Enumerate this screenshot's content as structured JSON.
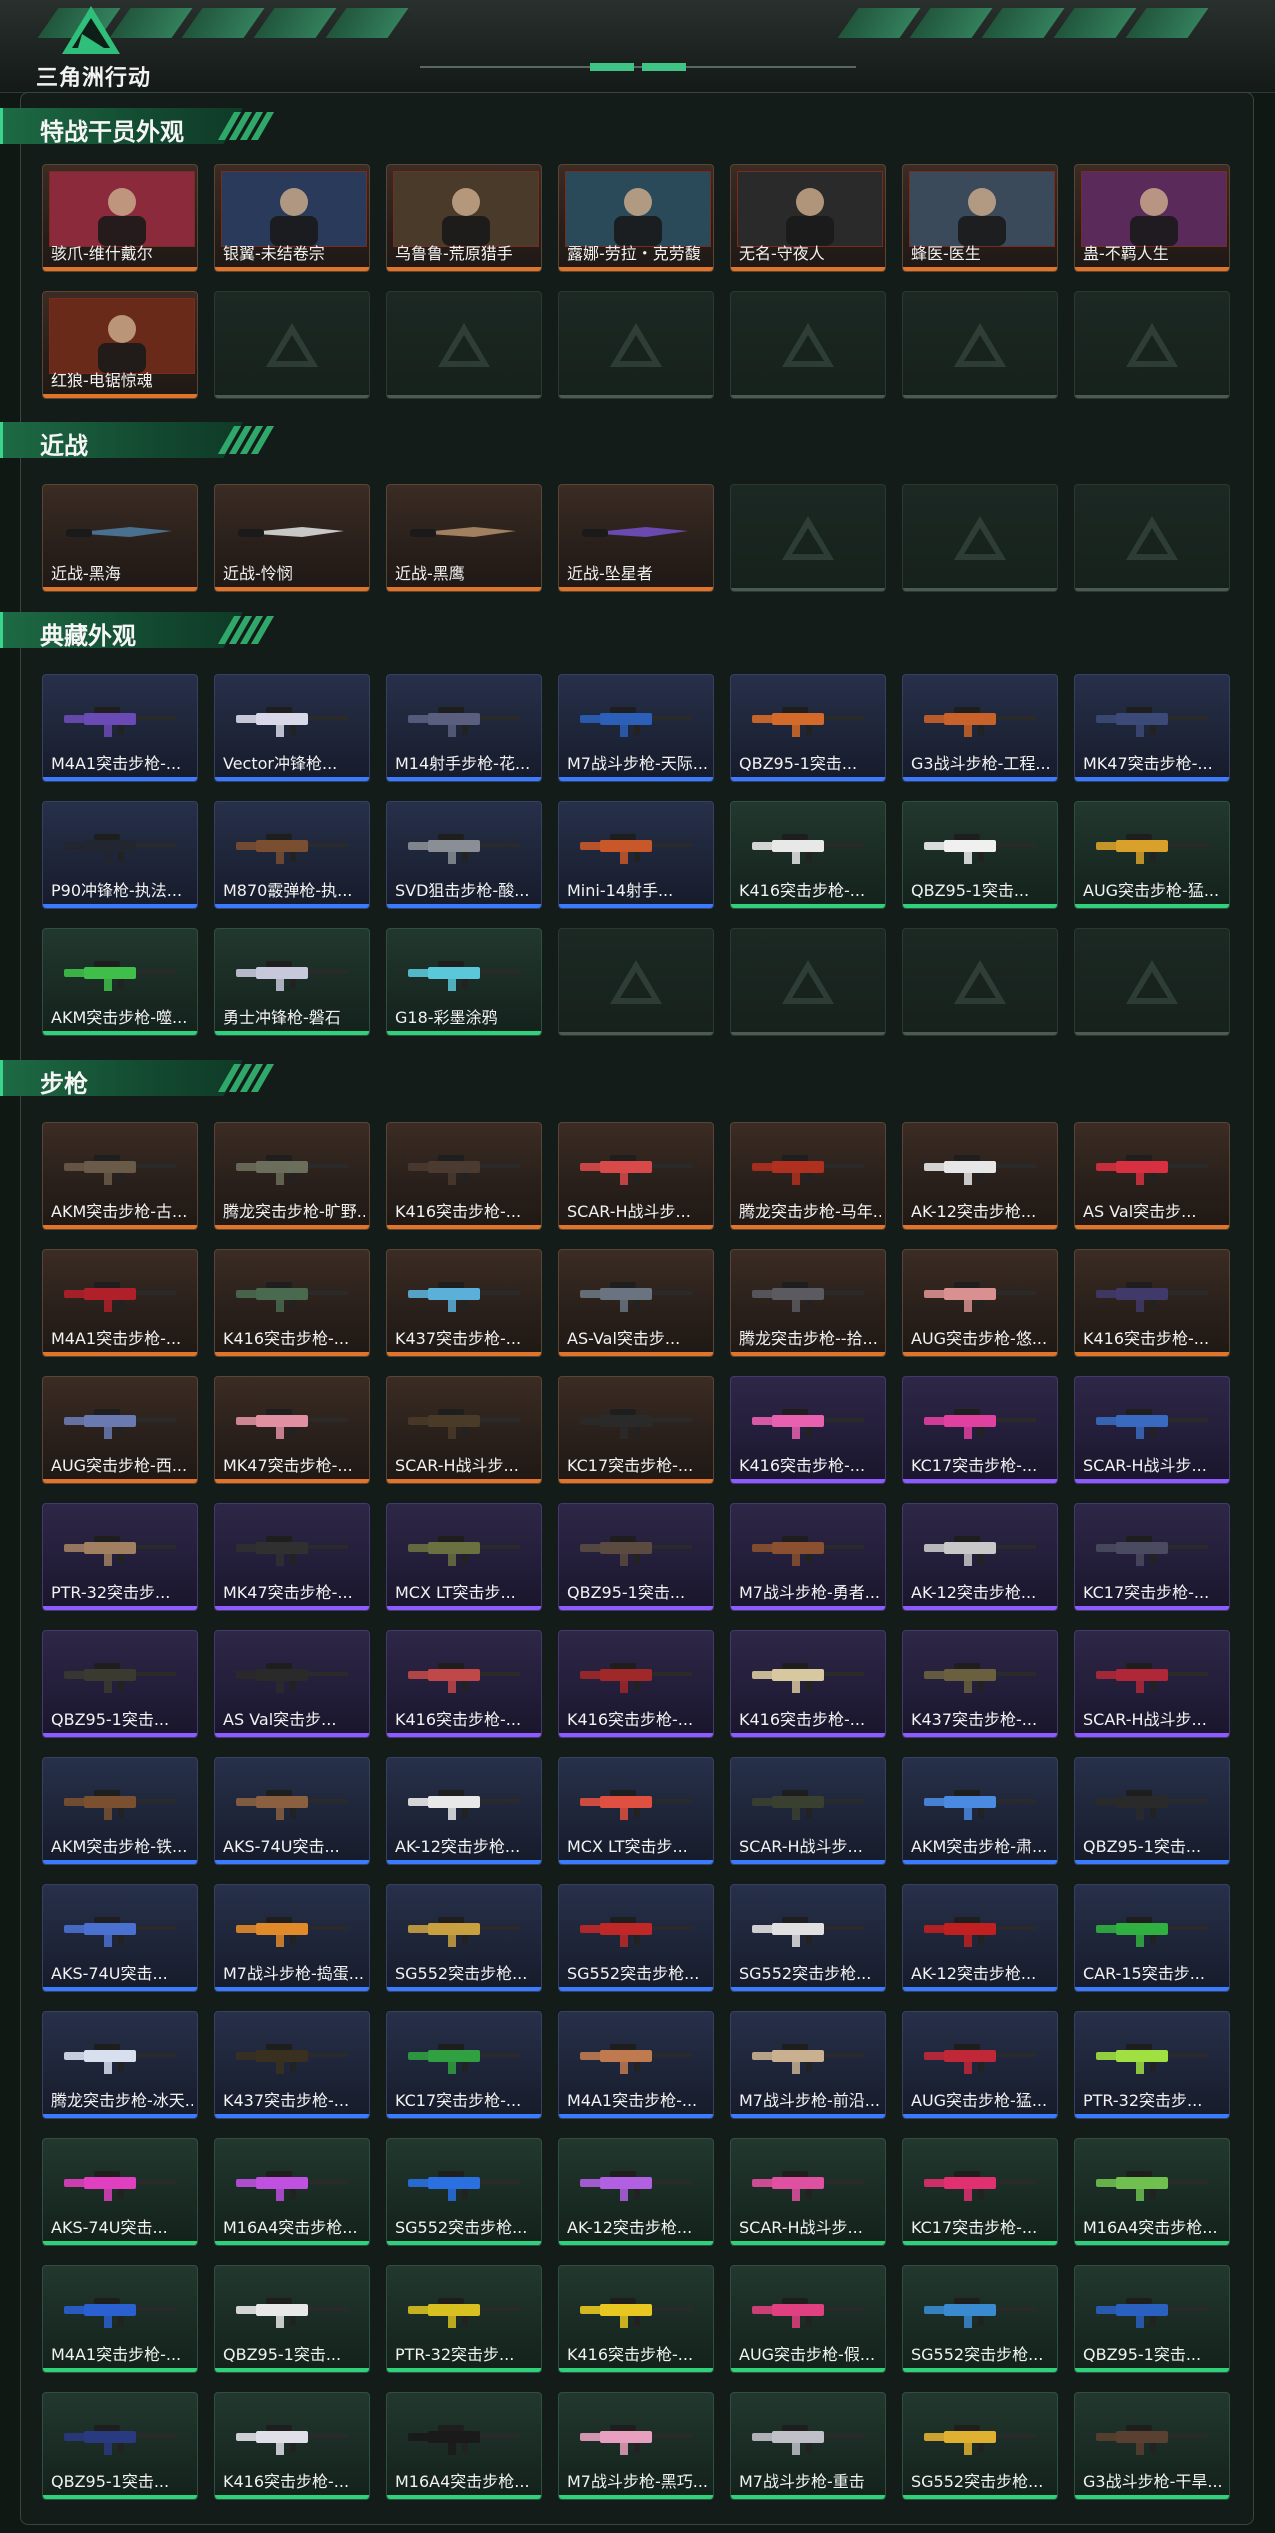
{
  "header": {
    "logo_text": "三角洲行动",
    "logo_icon": "delta-triangle-logo",
    "accent_color": "#3fc486"
  },
  "sections": [
    {
      "title": "特战干员外观",
      "items": [
        {
          "label": "骇爪-维什戴尔",
          "rarity": "gold",
          "kind": "portrait"
        },
        {
          "label": "银翼-未结卷宗",
          "rarity": "gold",
          "kind": "portrait"
        },
        {
          "label": "乌鲁鲁-荒原猎手",
          "rarity": "gold",
          "kind": "portrait"
        },
        {
          "label": "露娜-劳拉・克劳馥",
          "rarity": "gold",
          "kind": "portrait"
        },
        {
          "label": "无名-守夜人",
          "rarity": "gold",
          "kind": "portrait"
        },
        {
          "label": "蜂医-医生",
          "rarity": "gold",
          "kind": "portrait"
        },
        {
          "label": "蛊-不羁人生",
          "rarity": "gold",
          "kind": "portrait"
        },
        {
          "label": "红狼-电锯惊魂",
          "rarity": "gold",
          "kind": "portrait"
        },
        {
          "label": "",
          "rarity": "empty"
        },
        {
          "label": "",
          "rarity": "empty"
        },
        {
          "label": "",
          "rarity": "empty"
        },
        {
          "label": "",
          "rarity": "empty"
        },
        {
          "label": "",
          "rarity": "empty"
        },
        {
          "label": "",
          "rarity": "empty"
        }
      ]
    },
    {
      "title": "近战",
      "items": [
        {
          "label": "近战-黑海",
          "rarity": "gold",
          "kind": "melee"
        },
        {
          "label": "近战-怜悯",
          "rarity": "gold",
          "kind": "melee"
        },
        {
          "label": "近战-黑鹰",
          "rarity": "gold",
          "kind": "melee"
        },
        {
          "label": "近战-坠星者",
          "rarity": "gold",
          "kind": "melee"
        },
        {
          "label": "",
          "rarity": "empty"
        },
        {
          "label": "",
          "rarity": "empty"
        },
        {
          "label": "",
          "rarity": "empty"
        }
      ]
    },
    {
      "title": "典藏外观",
      "items": [
        {
          "label": "M4A1突击步枪-...",
          "rarity": "blue",
          "color": "#6a4bb5"
        },
        {
          "label": "Vector冲锋枪...",
          "rarity": "blue",
          "color": "#d8d8e8"
        },
        {
          "label": "M14射手步枪-花...",
          "rarity": "blue",
          "color": "#5a5f80"
        },
        {
          "label": "M7战斗步枪-天际...",
          "rarity": "blue",
          "color": "#2b5fb8"
        },
        {
          "label": "QBZ95-1突击...",
          "rarity": "blue",
          "color": "#d46a2a"
        },
        {
          "label": "G3战斗步枪-工程...",
          "rarity": "blue",
          "color": "#c8612a"
        },
        {
          "label": "MK47突击步枪-...",
          "rarity": "blue",
          "color": "#3b4a78"
        },
        {
          "label": "P90冲锋枪-执法...",
          "rarity": "blue",
          "color": "#222630"
        },
        {
          "label": "M870霰弹枪-执...",
          "rarity": "blue",
          "color": "#7a4e30"
        },
        {
          "label": "SVD狙击步枪-酸...",
          "rarity": "blue",
          "color": "#8a8f95"
        },
        {
          "label": "Mini-14射手...",
          "rarity": "blue",
          "color": "#c8582a"
        },
        {
          "label": "K416突击步枪-...",
          "rarity": "green",
          "color": "#e8e8e8"
        },
        {
          "label": "QBZ95-1突击...",
          "rarity": "green",
          "color": "#f0f0f0"
        },
        {
          "label": "AUG突击步枪-猛...",
          "rarity": "green",
          "color": "#d9a12a"
        },
        {
          "label": "AKM突击步枪-噬...",
          "rarity": "green",
          "color": "#3fbf4a"
        },
        {
          "label": "勇士冲锋枪-磐石",
          "rarity": "green",
          "color": "#c8c8dc"
        },
        {
          "label": "G18-彩墨涂鸦",
          "rarity": "green",
          "color": "#5ac8d8"
        },
        {
          "label": "",
          "rarity": "empty"
        },
        {
          "label": "",
          "rarity": "empty"
        },
        {
          "label": "",
          "rarity": "empty"
        },
        {
          "label": "",
          "rarity": "empty"
        }
      ]
    },
    {
      "title": "步枪",
      "items": [
        {
          "label": "AKM突击步枪-古...",
          "rarity": "gold",
          "color": "#6a5a48"
        },
        {
          "label": "腾龙突击步枪-旷野...",
          "rarity": "gold",
          "color": "#6b6e5a"
        },
        {
          "label": "K416突击步枪-...",
          "rarity": "gold",
          "color": "#4a3a30"
        },
        {
          "label": "SCAR-H战斗步...",
          "rarity": "gold",
          "color": "#d84a4a"
        },
        {
          "label": "腾龙突击步枪-马年...",
          "rarity": "gold",
          "color": "#b03020"
        },
        {
          "label": "AK-12突击步枪...",
          "rarity": "gold",
          "color": "#e6e6e6"
        },
        {
          "label": "AS Val突击步...",
          "rarity": "gold",
          "color": "#d83040"
        },
        {
          "label": "M4A1突击步枪-...",
          "rarity": "gold",
          "color": "#b0202a"
        },
        {
          "label": "K416突击步枪-...",
          "rarity": "gold",
          "color": "#4a6a50"
        },
        {
          "label": "K437突击步枪-...",
          "rarity": "gold",
          "color": "#5ab0d8"
        },
        {
          "label": "AS-Val突击步...",
          "rarity": "gold",
          "color": "#6a7480"
        },
        {
          "label": "腾龙突击步枪--拾...",
          "rarity": "gold",
          "color": "#5a5a60"
        },
        {
          "label": "AUG突击步枪-悠...",
          "rarity": "gold",
          "color": "#d89090"
        },
        {
          "label": "K416突击步枪-...",
          "rarity": "gold",
          "color": "#403a6a"
        },
        {
          "label": "AUG突击步枪-西...",
          "rarity": "gold",
          "color": "#6a7ab0"
        },
        {
          "label": "MK47突击步枪-...",
          "rarity": "gold",
          "color": "#e090a0"
        },
        {
          "label": "SCAR-H战斗步...",
          "rarity": "gold",
          "color": "#4a3a28"
        },
        {
          "label": "KC17突击步枪-...",
          "rarity": "gold",
          "color": "#2a2a2a"
        },
        {
          "label": "K416突击步枪-...",
          "rarity": "purple",
          "color": "#e860b0"
        },
        {
          "label": "KC17突击步枪-...",
          "rarity": "purple",
          "color": "#e040a0"
        },
        {
          "label": "SCAR-H战斗步...",
          "rarity": "purple",
          "color": "#3a6ac0"
        },
        {
          "label": "PTR-32突击步...",
          "rarity": "purple",
          "color": "#a08060"
        },
        {
          "label": "MK47突击步枪-...",
          "rarity": "purple",
          "color": "#303030"
        },
        {
          "label": "MCX LT突击步...",
          "rarity": "purple",
          "color": "#6a7040"
        },
        {
          "label": "QBZ95-1突击...",
          "rarity": "purple",
          "color": "#5a4a40"
        },
        {
          "label": "M7战斗步枪-勇者...",
          "rarity": "purple",
          "color": "#8a5030"
        },
        {
          "label": "AK-12突击步枪...",
          "rarity": "purple",
          "color": "#c8c8c8"
        },
        {
          "label": "KC17突击步枪-...",
          "rarity": "purple",
          "color": "#4a4a60"
        },
        {
          "label": "QBZ95-1突击...",
          "rarity": "purple",
          "color": "#3a3a30"
        },
        {
          "label": "AS Val突击步...",
          "rarity": "purple",
          "color": "#2a2a2a"
        },
        {
          "label": "K416突击步枪-...",
          "rarity": "purple",
          "color": "#c04848"
        },
        {
          "label": "K416突击步枪-...",
          "rarity": "purple",
          "color": "#a02828"
        },
        {
          "label": "K416突击步枪-...",
          "rarity": "purple",
          "color": "#d8c8a0"
        },
        {
          "label": "K437突击步枪-...",
          "rarity": "purple",
          "color": "#6a6040"
        },
        {
          "label": "SCAR-H战斗步...",
          "rarity": "purple",
          "color": "#b02838"
        },
        {
          "label": "AKM突击步枪-铁...",
          "rarity": "blue",
          "color": "#7a5030"
        },
        {
          "label": "AKS-74U突击...",
          "rarity": "blue",
          "color": "#8a6040"
        },
        {
          "label": "AK-12突击步枪...",
          "rarity": "blue",
          "color": "#e8e8e8"
        },
        {
          "label": "MCX LT突击步...",
          "rarity": "blue",
          "color": "#e05040"
        },
        {
          "label": "SCAR-H战斗步...",
          "rarity": "blue",
          "color": "#3a4030"
        },
        {
          "label": "AKM突击步枪-肃...",
          "rarity": "blue",
          "color": "#4a8ae0"
        },
        {
          "label": "QBZ95-1突击...",
          "rarity": "blue",
          "color": "#2a2a2a"
        },
        {
          "label": "AKS-74U突击...",
          "rarity": "blue",
          "color": "#4a70d0"
        },
        {
          "label": "M7战斗步枪-捣蛋...",
          "rarity": "blue",
          "color": "#e08a2a"
        },
        {
          "label": "SG552突击步枪...",
          "rarity": "blue",
          "color": "#c8a040"
        },
        {
          "label": "SG552突击步枪...",
          "rarity": "blue",
          "color": "#c02828"
        },
        {
          "label": "SG552突击步枪...",
          "rarity": "blue",
          "color": "#e0e0e0"
        },
        {
          "label": "AK-12突击步枪...",
          "rarity": "blue",
          "color": "#c02020"
        },
        {
          "label": "CAR-15突击步...",
          "rarity": "blue",
          "color": "#30b040"
        },
        {
          "label": "腾龙突击步枪-冰天...",
          "rarity": "blue",
          "color": "#d8e0f0"
        },
        {
          "label": "K437突击步枪-...",
          "rarity": "blue",
          "color": "#3a3020"
        },
        {
          "label": "KC17突击步枪-...",
          "rarity": "blue",
          "color": "#30a040"
        },
        {
          "label": "M4A1突击步枪-...",
          "rarity": "blue",
          "color": "#c07a50"
        },
        {
          "label": "M7战斗步枪-前沿...",
          "rarity": "blue",
          "color": "#c8b090"
        },
        {
          "label": "AUG突击步枪-猛...",
          "rarity": "blue",
          "color": "#c02838"
        },
        {
          "label": "PTR-32突击步...",
          "rarity": "blue",
          "color": "#a0e040"
        },
        {
          "label": "AKS-74U突击...",
          "rarity": "green",
          "color": "#e040c0"
        },
        {
          "label": "M16A4突击步枪...",
          "rarity": "green",
          "color": "#c050e0"
        },
        {
          "label": "SG552突击步枪...",
          "rarity": "green",
          "color": "#2a70e0"
        },
        {
          "label": "AK-12突击步枪...",
          "rarity": "green",
          "color": "#b060e0"
        },
        {
          "label": "SCAR-H战斗步...",
          "rarity": "green",
          "color": "#e050a0"
        },
        {
          "label": "KC17突击步枪-...",
          "rarity": "green",
          "color": "#e03070"
        },
        {
          "label": "M16A4突击步枪...",
          "rarity": "green",
          "color": "#70c050"
        },
        {
          "label": "M4A1突击步枪-...",
          "rarity": "green",
          "color": "#2a60d0"
        },
        {
          "label": "QBZ95-1突击...",
          "rarity": "green",
          "color": "#e8e8e8"
        },
        {
          "label": "PTR-32突击步...",
          "rarity": "green",
          "color": "#d8c020"
        },
        {
          "label": "K416突击步枪-...",
          "rarity": "green",
          "color": "#e8c820"
        },
        {
          "label": "AUG突击步枪-假...",
          "rarity": "green",
          "color": "#e04080"
        },
        {
          "label": "SG552突击步枪...",
          "rarity": "green",
          "color": "#3a8ad0"
        },
        {
          "label": "QBZ95-1突击...",
          "rarity": "green",
          "color": "#2a60c0"
        },
        {
          "label": "QBZ95-1突击...",
          "rarity": "green",
          "color": "#2a3a80"
        },
        {
          "label": "K416突击步枪-...",
          "rarity": "green",
          "color": "#e0e0e8"
        },
        {
          "label": "M16A4突击步枪...",
          "rarity": "green",
          "color": "#1a1a1a"
        },
        {
          "label": "M7战斗步枪-黑巧...",
          "rarity": "green",
          "color": "#e8a0c0"
        },
        {
          "label": "M7战斗步枪-重击",
          "rarity": "green",
          "color": "#c0c0c8"
        },
        {
          "label": "SG552突击步枪...",
          "rarity": "green",
          "color": "#e0b030"
        },
        {
          "label": "G3战斗步枪-干旱...",
          "rarity": "green",
          "color": "#5a4030"
        }
      ]
    }
  ]
}
